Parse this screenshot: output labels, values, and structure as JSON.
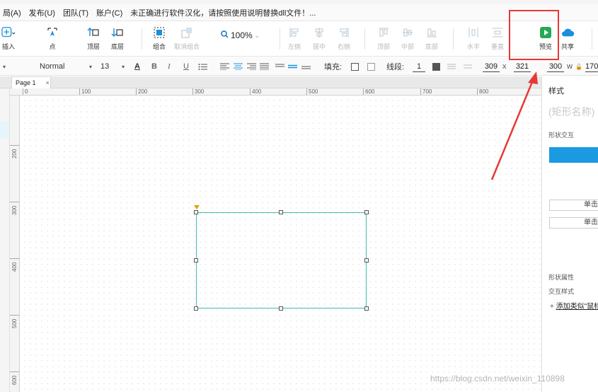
{
  "menubar": {
    "items": [
      "局(A)",
      "发布(U)",
      "团队(T)",
      "账户(C)"
    ],
    "notice": "未正确进行软件汉化，请按照使用说明替换dll文件！..."
  },
  "toolbar": {
    "insert_label": "插入",
    "point_label": "点",
    "top_label": "顶层",
    "bottom_label": "底层",
    "group_label": "组合",
    "ungroup_label": "取消组合",
    "zoom_value": "100%",
    "left_label": "左侧",
    "center_label": "居中",
    "right_label": "右侧",
    "top_align_label": "顶部",
    "middle_label": "中部",
    "bottom_align_label": "底部",
    "horizontal_label": "水平",
    "vertical_label": "垂直",
    "preview_label": "预览",
    "share_label": "共享"
  },
  "formatbar": {
    "font_style": "Normal",
    "font_size": "13",
    "fill_label": "填充:",
    "line_label": "线段:",
    "line_value": "1",
    "x_value": "309",
    "x_label": "x",
    "y_value": "321",
    "w_value": "300",
    "w_label": "w",
    "h_value": "170"
  },
  "tabs": {
    "page_name": "Page 1",
    "close": "×"
  },
  "ruler": {
    "h_labels": [
      "0",
      "100",
      "200",
      "300",
      "400",
      "500",
      "600",
      "700",
      "800"
    ],
    "v_labels": [
      "200",
      "300",
      "400",
      "500",
      "600"
    ]
  },
  "rightpanel": {
    "title": "样式",
    "shape_name_placeholder": "(矩形名称)",
    "interaction_label": "形状交互",
    "btn1_label": "单击",
    "btn2_label": "单击",
    "shape_props_label": "形状属性",
    "interaction_style_label": "交互样式",
    "add_label": "添加类似\"鼠标"
  },
  "watermark": "https://blog.csdn.net/weixin_110898",
  "colors": {
    "preview_green": "#27a857",
    "share_blue": "#1a8fdc",
    "shape_border": "#40bcae",
    "highlight_red": "#e53935"
  }
}
